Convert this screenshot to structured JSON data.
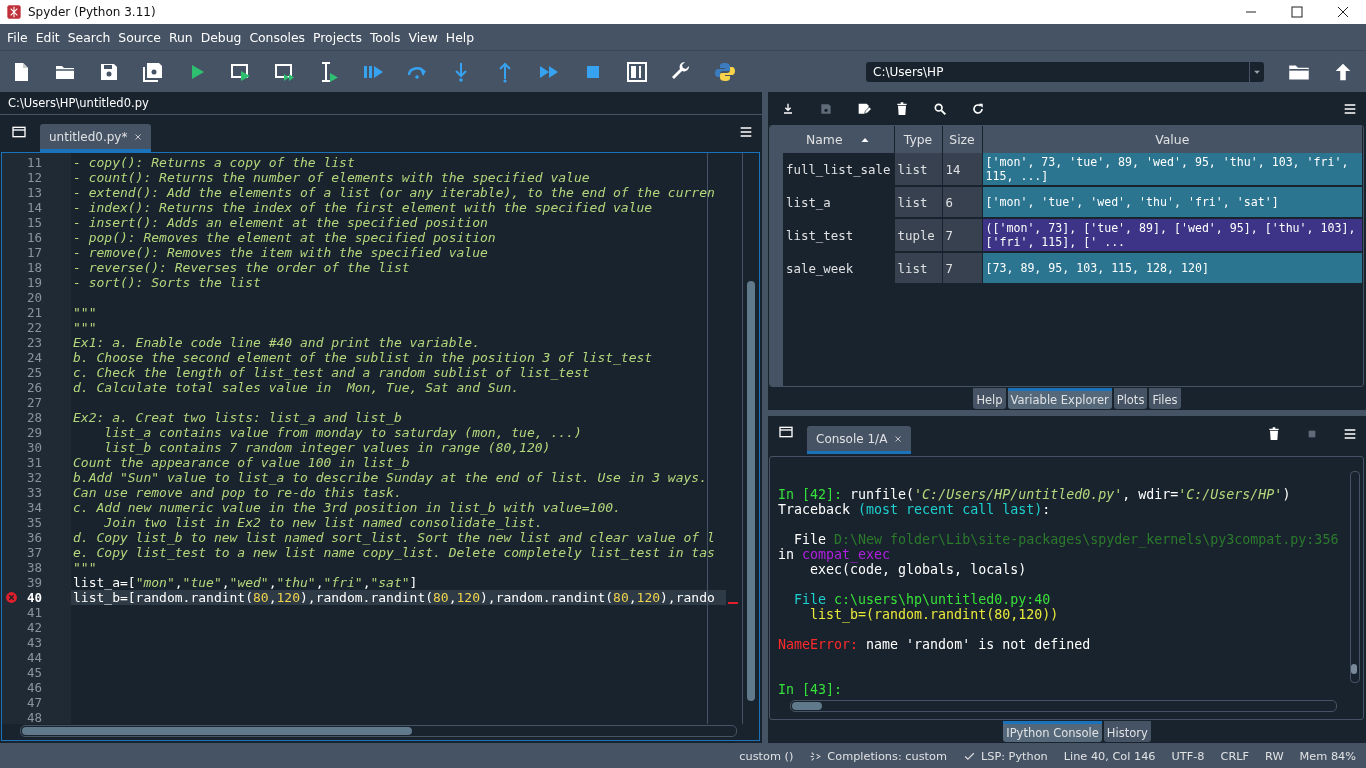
{
  "window": {
    "title": "Spyder (Python 3.11)"
  },
  "menu": [
    {
      "label": "File"
    },
    {
      "label": "Edit"
    },
    {
      "label": "Search"
    },
    {
      "label": "Source"
    },
    {
      "label": "Run"
    },
    {
      "label": "Debug"
    },
    {
      "label": "Consoles"
    },
    {
      "label": "Projects"
    },
    {
      "label": "Tools"
    },
    {
      "label": "View"
    },
    {
      "label": "Help"
    }
  ],
  "working_directory": {
    "value": "C:\\Users\\HP"
  },
  "editor": {
    "file_path": "C:\\Users\\HP\\untitled0.py",
    "tabs": [
      {
        "label": "untitled0.py*",
        "selected": true
      }
    ],
    "lines": [
      {
        "number": "11",
        "current": false,
        "error": false,
        "segments": [
          {
            "kind": "doc",
            "text": "- copy(): Returns a copy of the list"
          }
        ]
      },
      {
        "number": "12",
        "current": false,
        "error": false,
        "segments": [
          {
            "kind": "doc",
            "text": "- count(): Returns the number of elements with the specified value"
          }
        ]
      },
      {
        "number": "13",
        "current": false,
        "error": false,
        "segments": [
          {
            "kind": "doc",
            "text": "- extend(): Add the elements of a list (or any iterable), to the end of the curren"
          }
        ]
      },
      {
        "number": "14",
        "current": false,
        "error": false,
        "segments": [
          {
            "kind": "doc",
            "text": "- index(): Returns the index of the first element with the specified value"
          }
        ]
      },
      {
        "number": "15",
        "current": false,
        "error": false,
        "segments": [
          {
            "kind": "doc",
            "text": "- insert(): Adds an element at the specified position"
          }
        ]
      },
      {
        "number": "16",
        "current": false,
        "error": false,
        "segments": [
          {
            "kind": "doc",
            "text": "- pop(): Removes the element at the specified position"
          }
        ]
      },
      {
        "number": "17",
        "current": false,
        "error": false,
        "segments": [
          {
            "kind": "doc",
            "text": "- remove(): Removes the item with the specified value"
          }
        ]
      },
      {
        "number": "18",
        "current": false,
        "error": false,
        "segments": [
          {
            "kind": "doc",
            "text": "- reverse(): Reverses the order of the list"
          }
        ]
      },
      {
        "number": "19",
        "current": false,
        "error": false,
        "segments": [
          {
            "kind": "doc",
            "text": "- sort(): Sorts the list"
          }
        ]
      },
      {
        "number": "20",
        "current": false,
        "error": false
      },
      {
        "number": "21",
        "current": false,
        "error": false,
        "segments": [
          {
            "kind": "doc",
            "text": "\"\"\""
          }
        ]
      },
      {
        "number": "22",
        "current": false,
        "error": false,
        "segments": [
          {
            "kind": "doc",
            "text": "\"\"\""
          }
        ]
      },
      {
        "number": "23",
        "current": false,
        "error": false,
        "segments": [
          {
            "kind": "doc",
            "text": "Ex1: a. Enable code line #40 and print the variable."
          }
        ]
      },
      {
        "number": "24",
        "current": false,
        "error": false,
        "segments": [
          {
            "kind": "doc",
            "text": "b. Choose the second element of the sublist in the position 3 of list_test"
          }
        ]
      },
      {
        "number": "25",
        "current": false,
        "error": false,
        "segments": [
          {
            "kind": "doc",
            "text": "c. Check the length of list_test and a random sublist of list_test"
          }
        ]
      },
      {
        "number": "26",
        "current": false,
        "error": false,
        "segments": [
          {
            "kind": "doc",
            "text": "d. Calculate total sales value in  Mon, Tue, Sat and Sun."
          }
        ]
      },
      {
        "number": "27",
        "current": false,
        "error": false
      },
      {
        "number": "28",
        "current": false,
        "error": false,
        "segments": [
          {
            "kind": "doc",
            "text": "Ex2: a. Creat two lists: list_a and list_b"
          }
        ]
      },
      {
        "number": "29",
        "current": false,
        "error": false,
        "segments": [
          {
            "kind": "doc",
            "text": "    list_a contains value from monday to saturday (mon, tue, ...)"
          }
        ]
      },
      {
        "number": "30",
        "current": false,
        "error": false,
        "segments": [
          {
            "kind": "doc",
            "text": "    list_b contains 7 random integer values in range (80,120)"
          }
        ]
      },
      {
        "number": "31",
        "current": false,
        "error": false,
        "segments": [
          {
            "kind": "doc",
            "text": "Count the appearance of value 100 in list_b"
          }
        ]
      },
      {
        "number": "32",
        "current": false,
        "error": false,
        "segments": [
          {
            "kind": "doc",
            "text": "b.Add \"Sun\" value to list_a to describe Sunday at the end of list. Use in 3 ways."
          }
        ]
      },
      {
        "number": "33",
        "current": false,
        "error": false,
        "segments": [
          {
            "kind": "doc",
            "text": "Can use remove and pop to re-do this task."
          }
        ]
      },
      {
        "number": "34",
        "current": false,
        "error": false,
        "segments": [
          {
            "kind": "doc",
            "text": "c. Add new numeric value in the 3rd position in list_b with value=100."
          }
        ]
      },
      {
        "number": "35",
        "current": false,
        "error": false,
        "segments": [
          {
            "kind": "doc",
            "text": "    Join two list in Ex2 to new list named consolidate_list."
          }
        ]
      },
      {
        "number": "36",
        "current": false,
        "error": false,
        "segments": [
          {
            "kind": "doc",
            "text": "d. Copy list_b to new list named sort_list. Sort the new list and clear value of l"
          }
        ]
      },
      {
        "number": "37",
        "current": false,
        "error": false,
        "segments": [
          {
            "kind": "doc",
            "text": "e. Copy list_test to a new list name copy_list. Delete completely list_test in tas"
          }
        ]
      },
      {
        "number": "38",
        "current": false,
        "error": false,
        "segments": [
          {
            "kind": "doc",
            "text": "\"\"\""
          }
        ]
      },
      {
        "number": "39",
        "current": false,
        "error": false,
        "segments": [
          {
            "kind": "code",
            "text": "list_a=["
          },
          {
            "kind": "str",
            "text": "\"mon\""
          },
          {
            "kind": "code",
            "text": ","
          },
          {
            "kind": "str",
            "text": "\"tue\""
          },
          {
            "kind": "code",
            "text": ","
          },
          {
            "kind": "str",
            "text": "\"wed\""
          },
          {
            "kind": "code",
            "text": ","
          },
          {
            "kind": "str",
            "text": "\"thu\""
          },
          {
            "kind": "code",
            "text": ","
          },
          {
            "kind": "str",
            "text": "\"fri\""
          },
          {
            "kind": "code",
            "text": ","
          },
          {
            "kind": "str",
            "text": "\"sat\""
          },
          {
            "kind": "code",
            "text": "]"
          }
        ]
      },
      {
        "number": "40",
        "current": true,
        "error": true,
        "segments": [
          {
            "kind": "code",
            "text": "list_b=[random.randint("
          },
          {
            "kind": "num",
            "text": "80"
          },
          {
            "kind": "code",
            "text": ","
          },
          {
            "kind": "num",
            "text": "120"
          },
          {
            "kind": "code",
            "text": "),random.randint("
          },
          {
            "kind": "num",
            "text": "80"
          },
          {
            "kind": "code",
            "text": ","
          },
          {
            "kind": "num",
            "text": "120"
          },
          {
            "kind": "code",
            "text": "),random.randint("
          },
          {
            "kind": "num",
            "text": "80"
          },
          {
            "kind": "code",
            "text": ","
          },
          {
            "kind": "num",
            "text": "120"
          },
          {
            "kind": "code",
            "text": "),rando"
          }
        ]
      },
      {
        "number": "41",
        "current": false,
        "error": false
      },
      {
        "number": "42",
        "current": false,
        "error": false
      },
      {
        "number": "43",
        "current": false,
        "error": false
      },
      {
        "number": "44",
        "current": false,
        "error": false
      },
      {
        "number": "45",
        "current": false,
        "error": false
      },
      {
        "number": "46",
        "current": false,
        "error": false
      },
      {
        "number": "47",
        "current": false,
        "error": false
      },
      {
        "number": "48",
        "current": false,
        "error": false
      }
    ]
  },
  "variable_explorer": {
    "columns": [
      {
        "label": "Name",
        "sorted": true
      },
      {
        "label": "Type",
        "sorted": false
      },
      {
        "label": "Size",
        "sorted": false
      },
      {
        "label": "Value",
        "sorted": false
      }
    ],
    "rows": [
      {
        "name": "full_list_sale",
        "type": "list",
        "size": "14",
        "value": "['mon', 73, 'tue', 89, 'wed', 95, 'thu', 103, 'fri', 115, ...]",
        "color": "#2b7590"
      },
      {
        "name": "list_a",
        "type": "list",
        "size": "6",
        "value": "['mon', 'tue', 'wed', 'thu', 'fri', 'sat']",
        "color": "#2b7590"
      },
      {
        "name": "list_test",
        "type": "tuple",
        "size": "7",
        "value": "(['mon', 73], ['tue', 89], ['wed', 95], ['thu', 103], ['fri', 115], [' ...",
        "color": "#3e3487"
      },
      {
        "name": "sale_week",
        "type": "list",
        "size": "7",
        "value": "[73, 89, 95, 103, 115, 128, 120]",
        "color": "#2b7590"
      }
    ]
  },
  "pane_tabs": [
    {
      "label": "Help",
      "selected": false
    },
    {
      "label": "Variable Explorer",
      "selected": true
    },
    {
      "label": "Plots",
      "selected": false
    },
    {
      "label": "Files",
      "selected": false
    }
  ],
  "console": {
    "tabs": [
      {
        "label": "Console 1/A",
        "selected": true
      }
    ],
    "lines": [
      {
        "kind": "text",
        "segments": [
          {
            "kind": "prompt",
            "text": "In [42]: "
          },
          {
            "kind": "plain",
            "text": "runfile("
          },
          {
            "kind": "str",
            "text": "'C:/Users/HP/untitled0.py'"
          },
          {
            "kind": "plain",
            "text": ", wdir="
          },
          {
            "kind": "str",
            "text": "'C:/Users/HP'"
          },
          {
            "kind": "plain",
            "text": ")"
          }
        ]
      },
      {
        "kind": "text",
        "segments": [
          {
            "kind": "plain",
            "text": "Traceback "
          },
          {
            "kind": "cyan",
            "text": "(most recent call last)"
          },
          {
            "kind": "plain",
            "text": ":"
          }
        ]
      },
      {
        "kind": "blank"
      },
      {
        "kind": "text",
        "segments": [
          {
            "kind": "plain",
            "text": "  File "
          },
          {
            "kind": "path",
            "text": "D:\\New folder\\Lib\\site-packages\\spyder_kernels\\py3compat.py:356"
          }
        ]
      },
      {
        "kind": "text",
        "segments": [
          {
            "kind": "plain",
            "text": "in "
          },
          {
            "kind": "func",
            "text": "compat_exec"
          }
        ]
      },
      {
        "kind": "text",
        "segments": [
          {
            "kind": "plain",
            "text": "    exec(code, globals, locals)"
          }
        ]
      },
      {
        "kind": "blank"
      },
      {
        "kind": "text",
        "segments": [
          {
            "kind": "cyan",
            "text": "  File "
          },
          {
            "kind": "location",
            "text": "c:\\users\\hp\\untitled0.py:40"
          }
        ]
      },
      {
        "kind": "text",
        "segments": [
          {
            "kind": "code",
            "text": "    list_b=(random.randint(80,120))"
          }
        ]
      },
      {
        "kind": "blank"
      },
      {
        "kind": "text",
        "segments": [
          {
            "kind": "error",
            "text": "NameError:"
          },
          {
            "kind": "plain",
            "text": " name 'random' is not defined"
          }
        ]
      },
      {
        "kind": "blank"
      },
      {
        "kind": "blank"
      },
      {
        "kind": "text",
        "segments": [
          {
            "kind": "prompt",
            "text": "In [43]:"
          }
        ]
      }
    ]
  },
  "console_pane_tabs": [
    {
      "label": "IPython Console",
      "selected": true
    },
    {
      "label": "History",
      "selected": false
    }
  ],
  "status_bar": [
    {
      "kind": "text",
      "text": "custom ()"
    },
    {
      "kind": "completions",
      "text": "Completions: custom"
    },
    {
      "kind": "lsp",
      "text": "LSP: Python"
    },
    {
      "kind": "text",
      "text": "Line 40, Col 146"
    },
    {
      "kind": "text",
      "text": "UTF-8"
    },
    {
      "kind": "text",
      "text": "CRLF"
    },
    {
      "kind": "text",
      "text": "RW"
    },
    {
      "kind": "text",
      "text": "Mem 84%"
    }
  ]
}
